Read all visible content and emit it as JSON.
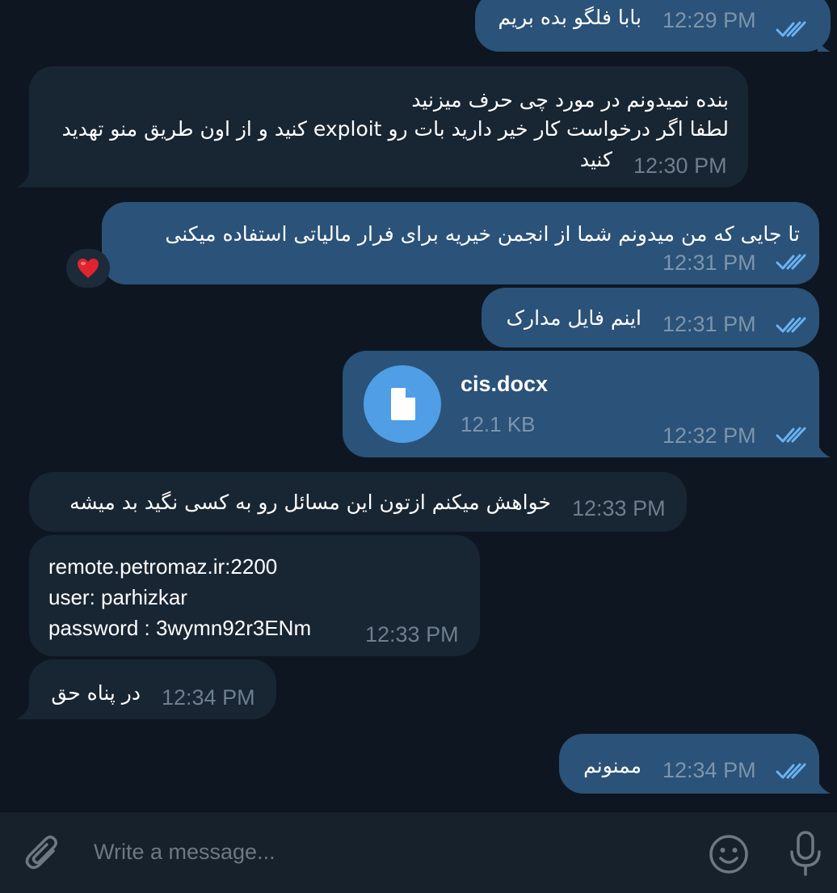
{
  "messages": [
    {
      "id": 1,
      "dir": "out",
      "text": "بابا فلگو بده بریم",
      "time": "12:29 PM",
      "read": true
    },
    {
      "id": 2,
      "dir": "in",
      "lines": [
        "بنده نمیدونم در مورد چی حرف میزنید",
        "لطفا اگر درخواست کار خیر دارید بات رو exploit کنید و از اون طریق منو تهدید",
        "کنید"
      ],
      "time": "12:30 PM"
    },
    {
      "id": 3,
      "dir": "out",
      "text": "تا جایی که من میدونم شما از انجمن خیریه برای فرار مالیاتی استفاده میکنی",
      "time": "12:31 PM",
      "read": true,
      "reaction": "heart"
    },
    {
      "id": 4,
      "dir": "out",
      "text": "اینم فایل مدارک",
      "time": "12:31 PM",
      "read": true
    },
    {
      "id": 5,
      "dir": "out",
      "file": {
        "name": "cis.docx",
        "size": "12.1 KB"
      },
      "time": "12:32 PM",
      "read": true
    },
    {
      "id": 6,
      "dir": "in",
      "text": "خواهش میکنم ازتون این مسائل رو به کسی نگید بد میشه",
      "time": "12:33 PM"
    },
    {
      "id": 7,
      "dir": "in",
      "link": "remote.petromaz.ir:2200",
      "lines": [
        "user: parhizkar",
        "password : 3wymn92r3ENm"
      ],
      "time": "12:33 PM"
    },
    {
      "id": 8,
      "dir": "in",
      "text": "در پناه حق",
      "time": "12:34 PM"
    },
    {
      "id": 9,
      "dir": "out",
      "text": "ممنونم",
      "time": "12:34 PM",
      "read": true
    }
  ],
  "composer": {
    "placeholder": "Write a message...",
    "attach_icon": "paperclip-icon",
    "emoji_icon": "emoji-icon",
    "mic_icon": "microphone-icon"
  },
  "colors": {
    "background": "#0e1621",
    "outgoing_bubble": "#2b5278",
    "incoming_bubble": "#182533",
    "link": "#6ab3f3",
    "check": "#6ab3f3",
    "file_icon": "#4f9ee6"
  }
}
